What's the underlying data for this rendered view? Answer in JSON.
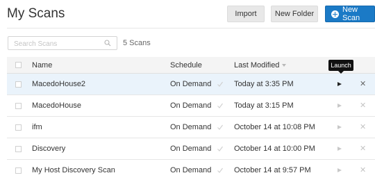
{
  "page": {
    "title": "My Scans"
  },
  "toolbar": {
    "import_label": "Import",
    "new_folder_label": "New Folder",
    "new_scan_label": "New Scan"
  },
  "search": {
    "placeholder": "Search Scans",
    "count_label": "5 Scans"
  },
  "table": {
    "headers": {
      "name": "Name",
      "schedule": "Schedule",
      "last_modified": "Last Modified"
    },
    "rows": [
      {
        "name": "MacedoHouse2",
        "schedule": "On Demand",
        "last_modified": "Today at 3:35 PM"
      },
      {
        "name": "MacedoHouse",
        "schedule": "On Demand",
        "last_modified": "Today at 3:15 PM"
      },
      {
        "name": "ifm",
        "schedule": "On Demand",
        "last_modified": "October 14 at 10:08 PM"
      },
      {
        "name": "Discovery",
        "schedule": "On Demand",
        "last_modified": "October 14 at 10:00 PM"
      },
      {
        "name": "My Host Discovery Scan",
        "schedule": "On Demand",
        "last_modified": "October 14 at 9:57 PM"
      }
    ]
  },
  "tooltip": {
    "text": "Launch"
  },
  "colors": {
    "accent": "#1b7ac6",
    "selected_row": "#eaf3fb",
    "header_bg": "#f4f4f4"
  },
  "icons": {
    "search": "search-icon",
    "plus": "plus-circle-icon",
    "play": "play-icon",
    "delete": "close-icon",
    "check": "check-icon",
    "sort": "sort-down-icon"
  }
}
